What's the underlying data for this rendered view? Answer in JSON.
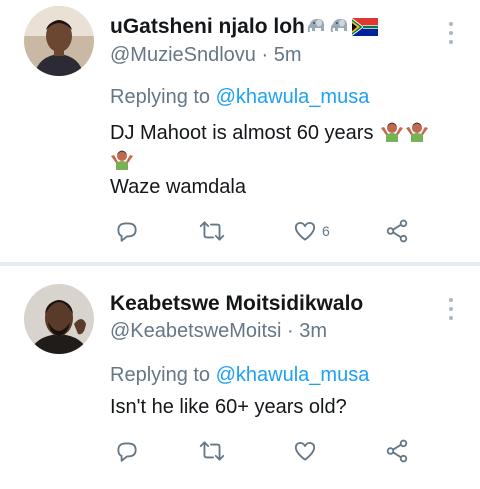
{
  "tweets": [
    {
      "display_name": "uGatsheni njalo loh",
      "name_emoji": [
        "elephant",
        "elephant",
        "south-africa-flag"
      ],
      "handle": "@MuzieSndlovu",
      "time": "· 5m",
      "replying_label": "Replying to",
      "replying_to": "@khawula_musa",
      "text_line_1": "DJ Mahoot is almost 60 years",
      "text_line_2": "Waze wamdala",
      "text_emoji": [
        "person-shrugging",
        "person-shrugging",
        "person-shrugging"
      ],
      "reply_count": "",
      "retweet_count": "",
      "like_count": "6",
      "actions": [
        "reply-icon",
        "retweet-icon",
        "like-icon",
        "share-icon"
      ]
    },
    {
      "display_name": "Keabetswe Moitsidikwalo",
      "handle": "@KeabetsweMoitsi",
      "time": "· 3m",
      "replying_label": "Replying to",
      "replying_to": "@khawula_musa",
      "text_line_1": "Isn't he like 60+ years old?",
      "reply_count": "",
      "retweet_count": "",
      "like_count": "",
      "actions": [
        "reply-icon",
        "retweet-icon",
        "like-icon",
        "share-icon"
      ]
    }
  ],
  "colors": {
    "accent": "#1da1f2",
    "secondary_text": "#657786",
    "primary_text": "#14171a",
    "divider": "#e6ecf0",
    "icon": "#657786"
  }
}
